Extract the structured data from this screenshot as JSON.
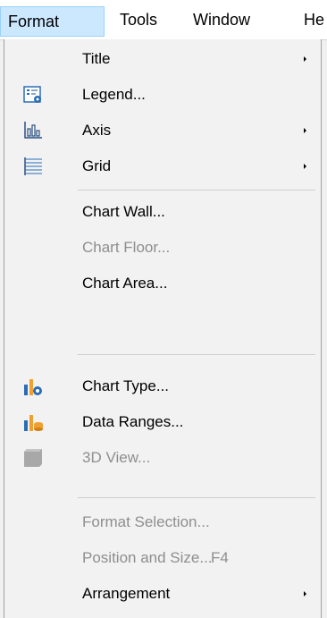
{
  "menubar": {
    "format": "Format",
    "tools": "Tools",
    "window": "Window",
    "help": "He"
  },
  "menu": {
    "title": "Title",
    "legend": "Legend...",
    "axis": "Axis",
    "grid": "Grid",
    "chart_wall": "Chart Wall...",
    "chart_floor": "Chart Floor...",
    "chart_area": "Chart Area...",
    "chart_type": "Chart Type...",
    "data_ranges": "Data Ranges...",
    "view_3d": "3D View...",
    "format_selection": "Format Selection...",
    "position_and_size": "Position and Size...",
    "position_and_size_shortcut": "F4",
    "arrangement": "Arrangement"
  },
  "icons": {
    "legend": "legend-icon",
    "axis": "axis-icon",
    "grid": "grid-icon",
    "chart_type": "chart-type-icon",
    "data_ranges": "data-ranges-icon",
    "view_3d": "3d-view-icon"
  },
  "colors": {
    "active_menu_bg": "#cce8ff",
    "active_menu_border": "#99d1ff",
    "icon_blue": "#2a6db5",
    "icon_orange": "#f0a030",
    "disabled_text": "#8e8e8e"
  }
}
